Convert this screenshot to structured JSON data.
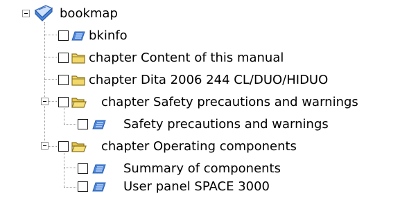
{
  "tree": {
    "root": {
      "label": "bookmap",
      "expanded": true,
      "icon": "bookmap-icon"
    },
    "items": [
      {
        "label": "bkinfo",
        "icon": "topic-icon",
        "checked": false
      },
      {
        "label": "chapter Content of this manual",
        "icon": "folder-closed-icon",
        "checked": false
      },
      {
        "label": "chapter Dita 2006 244 CL/DUO/HIDUO",
        "icon": "folder-closed-icon",
        "checked": false
      },
      {
        "label": "chapter Safety precautions and warnings",
        "icon": "folder-open-icon",
        "checked": false,
        "expanded": true,
        "children": [
          {
            "label": "Safety precautions and warnings",
            "icon": "topic-icon",
            "checked": false
          }
        ]
      },
      {
        "label": "chapter Operating components",
        "icon": "folder-open-icon",
        "checked": false,
        "expanded": true,
        "children": [
          {
            "label": "Summary of components",
            "icon": "topic-icon",
            "checked": false
          },
          {
            "label": "User panel SPACE 3000",
            "icon": "topic-icon",
            "checked": false
          }
        ]
      }
    ]
  },
  "colors": {
    "folder": "#f2d86a",
    "folder_border": "#8a7420",
    "topic": "#4a86e0",
    "line": "#9a9a9a"
  }
}
